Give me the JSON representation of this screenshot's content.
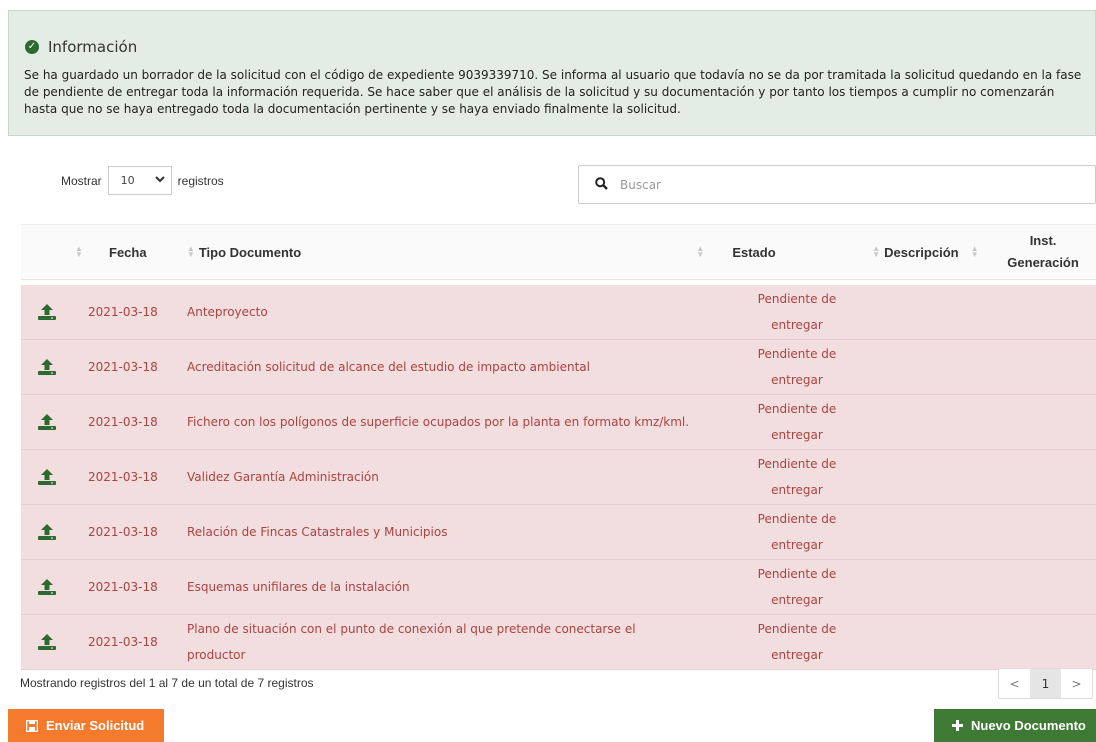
{
  "alert": {
    "title": "Información",
    "text": "Se ha guardado un borrador de la solicitud con el código de expediente 9039339710. Se informa al usuario que todavía no se da por tramitada la solicitud quedando en la fase de pendiente de entregar toda la información requerida. Se hace saber que el análisis de la solicitud y su documentación y por tanto los tiempos a cumplir no comenzarán hasta que no se haya entregado toda la documentación pertinente y se haya enviado finalmente la solicitud."
  },
  "length": {
    "prefix": "Mostrar",
    "value": "10",
    "suffix": "registros"
  },
  "search": {
    "placeholder": "Buscar"
  },
  "table": {
    "headers": {
      "fecha": "Fecha",
      "tipo": "Tipo Documento",
      "estado": "Estado",
      "descripcion": "Descripción",
      "inst_line1": "Inst.",
      "inst_line2": "Generación"
    },
    "rows": [
      {
        "fecha": "2021-03-18",
        "tipo": "Anteproyecto",
        "estado_1": "Pendiente de",
        "estado_2": "entregar"
      },
      {
        "fecha": "2021-03-18",
        "tipo": "Acreditación solicitud de alcance del estudio de impacto ambiental",
        "estado_1": "Pendiente de",
        "estado_2": "entregar"
      },
      {
        "fecha": "2021-03-18",
        "tipo": "Fichero con los polígonos de superficie ocupados por la planta en formato kmz/kml.",
        "estado_1": "Pendiente de",
        "estado_2": "entregar"
      },
      {
        "fecha": "2021-03-18",
        "tipo": "Validez Garantía Administración",
        "estado_1": "Pendiente de",
        "estado_2": "entregar"
      },
      {
        "fecha": "2021-03-18",
        "tipo": "Relación de Fincas Catastrales y Municipios",
        "estado_1": "Pendiente de",
        "estado_2": "entregar"
      },
      {
        "fecha": "2021-03-18",
        "tipo": "Esquemas unifilares de la instalación",
        "estado_1": "Pendiente de",
        "estado_2": "entregar"
      },
      {
        "fecha": "2021-03-18",
        "tipo": "Plano de situación con el punto de conexión al que pretende conectarse el productor",
        "estado_1": "Pendiente de",
        "estado_2": "entregar"
      }
    ]
  },
  "info": "Mostrando registros del 1 al 7 de un total de 7 registros",
  "pager": {
    "prev": "<",
    "current": "1",
    "next": ">"
  },
  "buttons": {
    "send": "Enviar Solicitud",
    "new": "Nuevo Documento"
  },
  "icons": {
    "alert": "check-circle-icon",
    "upload": "upload-icon",
    "search": "search-icon",
    "save": "floppy-icon",
    "plus": "plus-icon"
  },
  "colors": {
    "alert_bg": "#e3ede5",
    "row_bg": "#f2dede",
    "row_text": "#a94442",
    "send": "#f47a2d",
    "new": "#3f7a35",
    "icon_green": "#2d6a30"
  }
}
